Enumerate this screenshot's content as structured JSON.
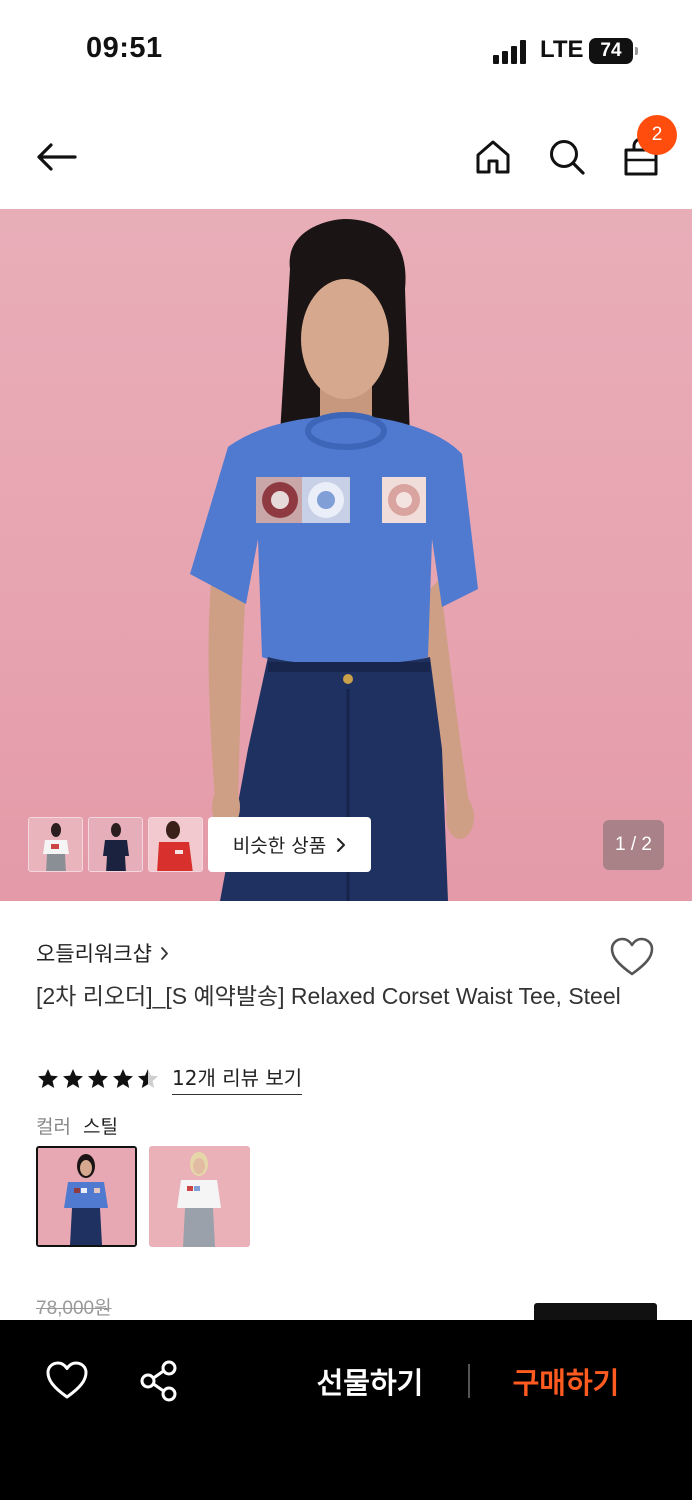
{
  "status_bar": {
    "time": "09:51",
    "network": "LTE",
    "battery": "74"
  },
  "nav": {
    "cart_count": "2"
  },
  "hero": {
    "similar_label": "비슷한 상품",
    "page_indicator": "1 / 2",
    "thumbnails": [
      "white-tee-look",
      "navy-tee-look",
      "red-tee-look"
    ]
  },
  "product": {
    "brand": "오들리워크샵",
    "title": "[2차 리오더]_[S 예약발송] Relaxed Corset Waist Tee, Steel",
    "rating": 4.5,
    "review_link": "12개 리뷰 보기",
    "color_label": "컬러",
    "color_value": "스틸",
    "swatches": [
      "steel",
      "white"
    ],
    "original_price": "78,000원"
  },
  "bottom_bar": {
    "gift_label": "선물하기",
    "buy_label": "구매하기"
  },
  "colors": {
    "accent": "#ff4d0d",
    "buy_text": "#ff5a1f",
    "hero_background": "#e8aeb8",
    "tee_blue": "#4f7ad0",
    "bottom_bar": "#000000"
  },
  "icons": {
    "back": "back-arrow-icon",
    "home": "home-icon",
    "search": "search-icon",
    "cart": "shopping-bag-icon",
    "like": "heart-icon",
    "share": "share-icon",
    "chevron": "chevron-right-icon",
    "star": "star-icon"
  }
}
